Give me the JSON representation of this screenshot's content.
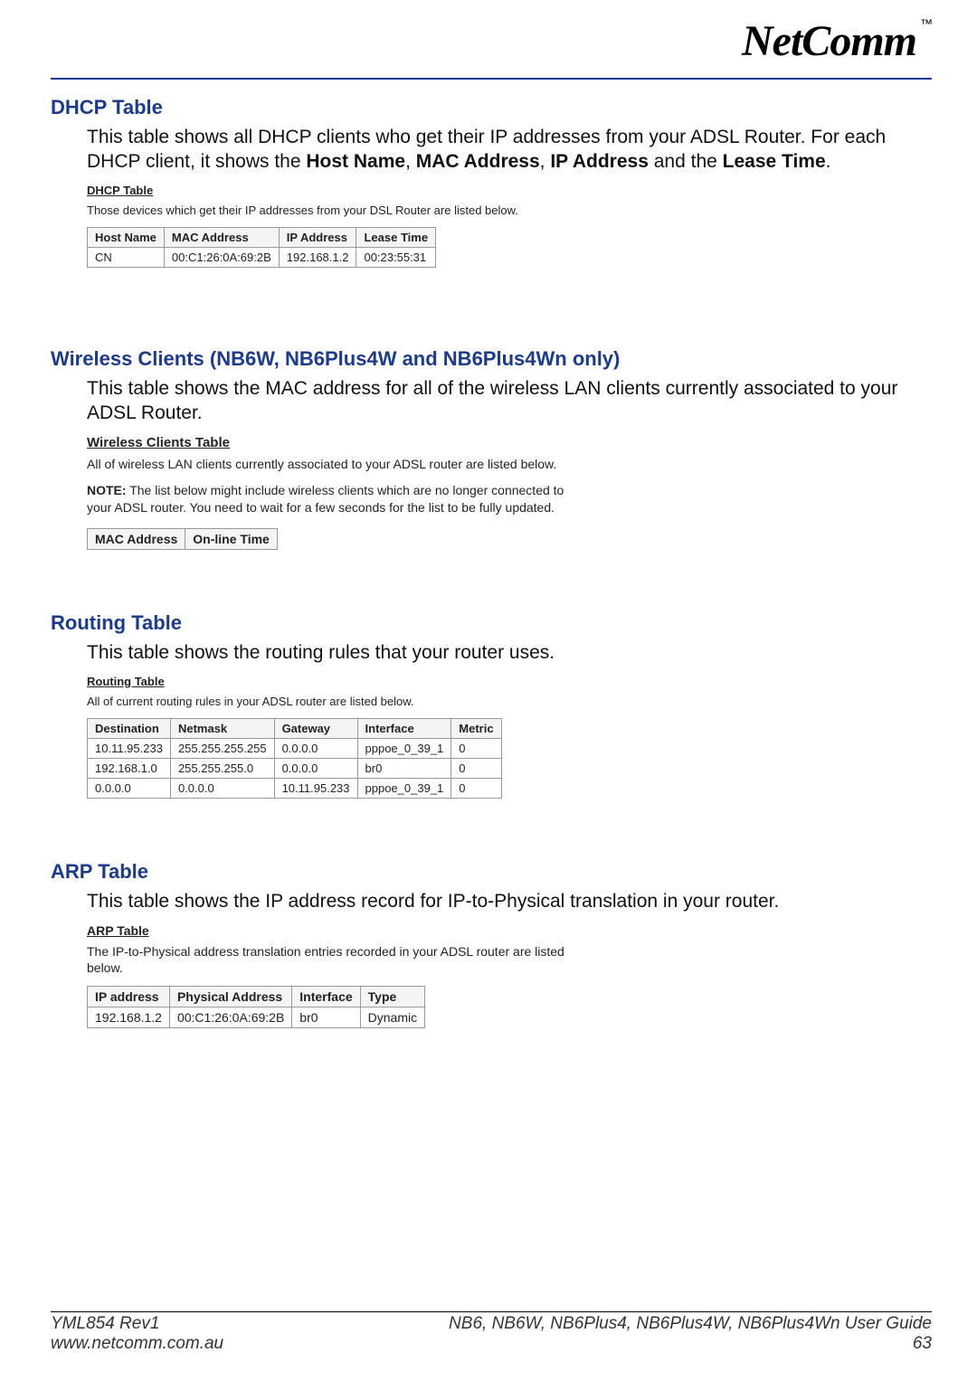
{
  "brand": {
    "name": "NetComm",
    "tm": "™"
  },
  "sections": {
    "dhcp": {
      "heading": "DHCP Table",
      "desc_prefix": "This table shows all DHCP clients who get their IP addresses from your ADSL Router. For each DHCP client, it shows the ",
      "b1": "Host Name",
      "c1": ", ",
      "b2": "MAC Address",
      "c2": ", ",
      "b3": "IP Address",
      "c3": " and the ",
      "b4": "Lease Time",
      "c4": ".",
      "sub_title": "DHCP Table",
      "sub_text": "Those devices which get their IP addresses from your DSL Router are listed below.",
      "headers": [
        "Host Name",
        "MAC Address",
        "IP Address",
        "Lease Time"
      ],
      "rows": [
        [
          "CN",
          "00:C1:26:0A:69:2B",
          "192.168.1.2",
          "00:23:55:31"
        ]
      ]
    },
    "wireless": {
      "heading": "Wireless Clients (NB6W, NB6Plus4W and NB6Plus4Wn only)",
      "desc": "This table shows the MAC address for all of the wireless LAN clients currently associated to your ADSL Router.",
      "sub_title": "Wireless Clients Table",
      "sub_text": "All of wireless LAN clients currently associated to your ADSL router are listed below.",
      "note_label": "NOTE:",
      "note_text": " The list below might include wireless clients which are no longer connected to your ADSL router. You need to wait for a few seconds for the list to be fully updated.",
      "headers": [
        "MAC Address",
        "On-line Time"
      ]
    },
    "routing": {
      "heading": "Routing Table",
      "desc": "This table shows the routing rules that your router uses.",
      "sub_title": "Routing Table",
      "sub_text": "All of current routing rules in your ADSL router are listed below.",
      "headers": [
        "Destination",
        "Netmask",
        "Gateway",
        "Interface",
        "Metric"
      ],
      "rows": [
        [
          "10.11.95.233",
          "255.255.255.255",
          "0.0.0.0",
          "pppoe_0_39_1",
          "0"
        ],
        [
          "192.168.1.0",
          "255.255.255.0",
          "0.0.0.0",
          "br0",
          "0"
        ],
        [
          "0.0.0.0",
          "0.0.0.0",
          "10.11.95.233",
          "pppoe_0_39_1",
          "0"
        ]
      ]
    },
    "arp": {
      "heading": "ARP Table",
      "desc": "This table shows the IP address record for IP-to-Physical translation in your router.",
      "sub_title": "ARP Table",
      "sub_text": "The IP-to-Physical address translation entries recorded in your ADSL router are listed below.",
      "headers": [
        "IP address",
        "Physical Address",
        "Interface",
        "Type"
      ],
      "rows": [
        [
          "192.168.1.2",
          "00:C1:26:0A:69:2B",
          "br0",
          "Dynamic"
        ]
      ]
    }
  },
  "footer": {
    "left1": "YML854 Rev1",
    "left2": "www.netcomm.com.au",
    "right1": "NB6, NB6W, NB6Plus4, NB6Plus4W, NB6Plus4Wn User Guide",
    "right2": "63"
  }
}
